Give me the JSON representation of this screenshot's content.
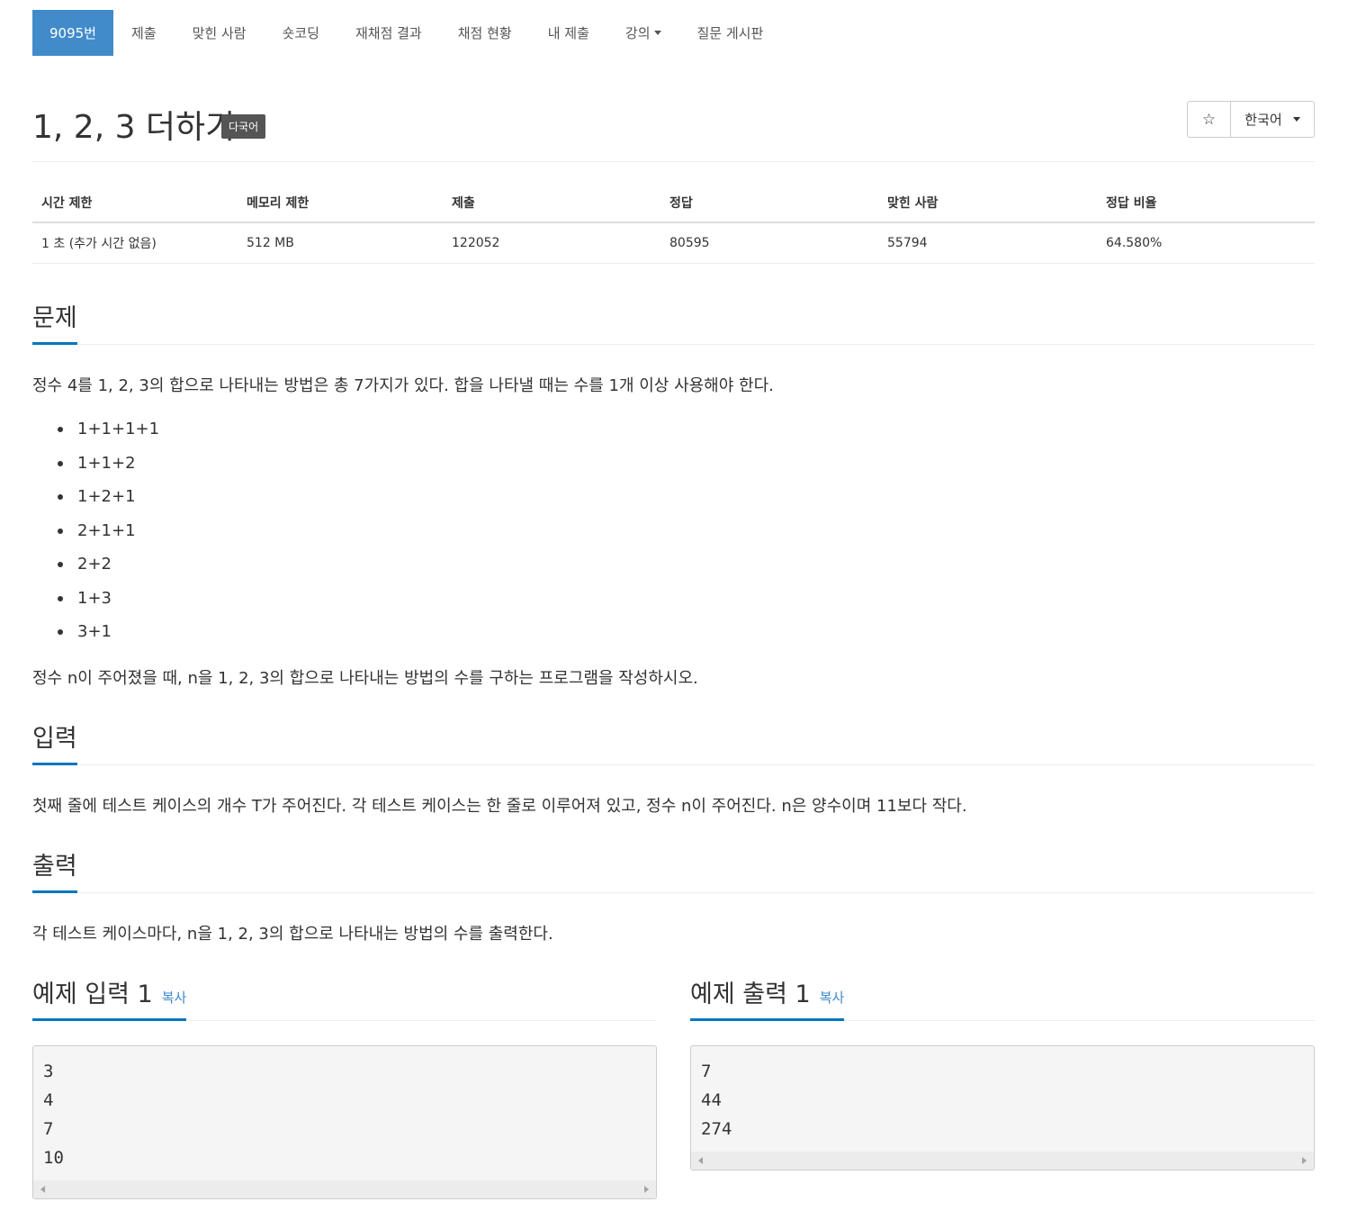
{
  "nav": {
    "items": [
      {
        "label": "9095번",
        "active": true
      },
      {
        "label": "제출"
      },
      {
        "label": "맞힌 사람"
      },
      {
        "label": "숏코딩"
      },
      {
        "label": "재채점 결과"
      },
      {
        "label": "채점 현황"
      },
      {
        "label": "내 제출"
      },
      {
        "label": "강의"
      },
      {
        "label": "질문 게시판"
      }
    ]
  },
  "problem": {
    "title": "1, 2, 3 더하기",
    "badge": "다국어",
    "star_icon": "☆",
    "language_select": "한국어"
  },
  "stats": {
    "headers": [
      "시간 제한",
      "메모리 제한",
      "제출",
      "정답",
      "맞힌 사람",
      "정답 비율"
    ],
    "values": [
      "1 초 (추가 시간 없음)",
      "512 MB",
      "122052",
      "80595",
      "55794",
      "64.580%"
    ]
  },
  "sections": {
    "description": {
      "heading": "문제",
      "intro": "정수 4를 1, 2, 3의 합으로 나타내는 방법은 총 7가지가 있다. 합을 나타낼 때는 수를 1개 이상 사용해야 한다.",
      "items": [
        "1+1+1+1",
        "1+1+2",
        "1+2+1",
        "2+1+1",
        "2+2",
        "1+3",
        "3+1"
      ],
      "outro": "정수 n이 주어졌을 때, n을 1, 2, 3의 합으로 나타내는 방법의 수를 구하는 프로그램을 작성하시오."
    },
    "input": {
      "heading": "입력",
      "text": "첫째 줄에 테스트 케이스의 개수 T가 주어진다. 각 테스트 케이스는 한 줄로 이루어져 있고, 정수 n이 주어진다. n은 양수이며 11보다 작다."
    },
    "output": {
      "heading": "출력",
      "text": "각 테스트 케이스마다, n을 1, 2, 3의 합으로 나타내는 방법의 수를 출력한다."
    }
  },
  "samples": {
    "input": {
      "heading": "예제 입력 1",
      "copy_label": "복사",
      "lines": [
        "3",
        "4",
        "7",
        "10"
      ]
    },
    "output": {
      "heading": "예제 출력 1",
      "copy_label": "복사",
      "lines": [
        "7",
        "44",
        "274"
      ]
    }
  },
  "colors": {
    "active_tab": "#428bca",
    "headline_underline": "#0076c0",
    "copy_link": "#428bca"
  }
}
